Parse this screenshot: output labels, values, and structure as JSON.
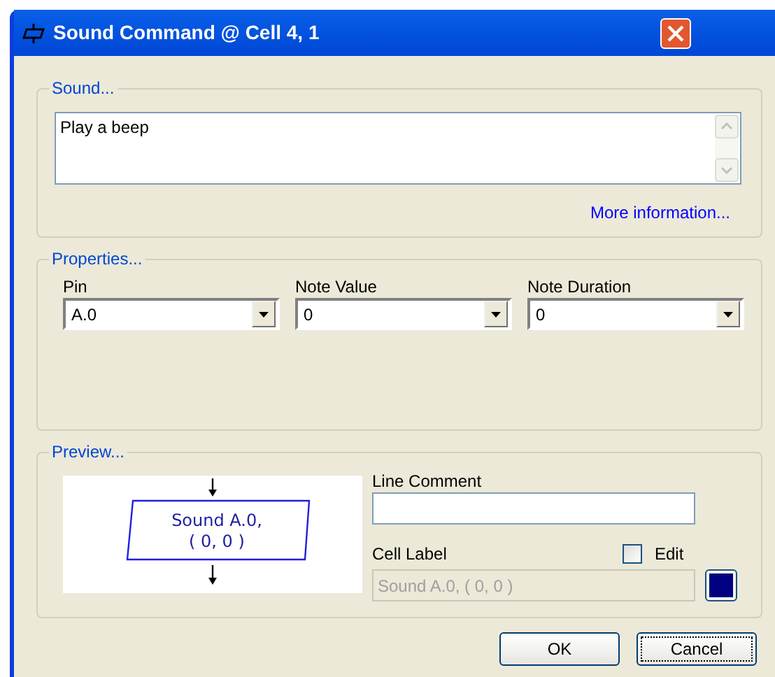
{
  "window": {
    "title": "Sound Command @ Cell 4, 1"
  },
  "sound": {
    "legend": "Sound...",
    "text": "Play a beep",
    "link": "More information..."
  },
  "properties": {
    "legend": "Properties...",
    "fields": [
      {
        "label": "Pin",
        "value": "A.0"
      },
      {
        "label": "Note Value",
        "value": "0"
      },
      {
        "label": "Note Duration",
        "value": "0"
      }
    ]
  },
  "preview": {
    "legend": "Preview...",
    "shape_lines": [
      "Sound A.0,",
      "( 0, 0 )"
    ],
    "line_comment": {
      "label": "Line Comment"
    },
    "cell_label": {
      "label": "Cell Label",
      "value": "Sound A.0, ( 0, 0 )",
      "disabled": true
    },
    "edit": {
      "label": "Edit",
      "checked": false
    }
  },
  "buttons": [
    {
      "label": "OK",
      "focused": false
    },
    {
      "label": "Cancel",
      "focused": true
    }
  ]
}
